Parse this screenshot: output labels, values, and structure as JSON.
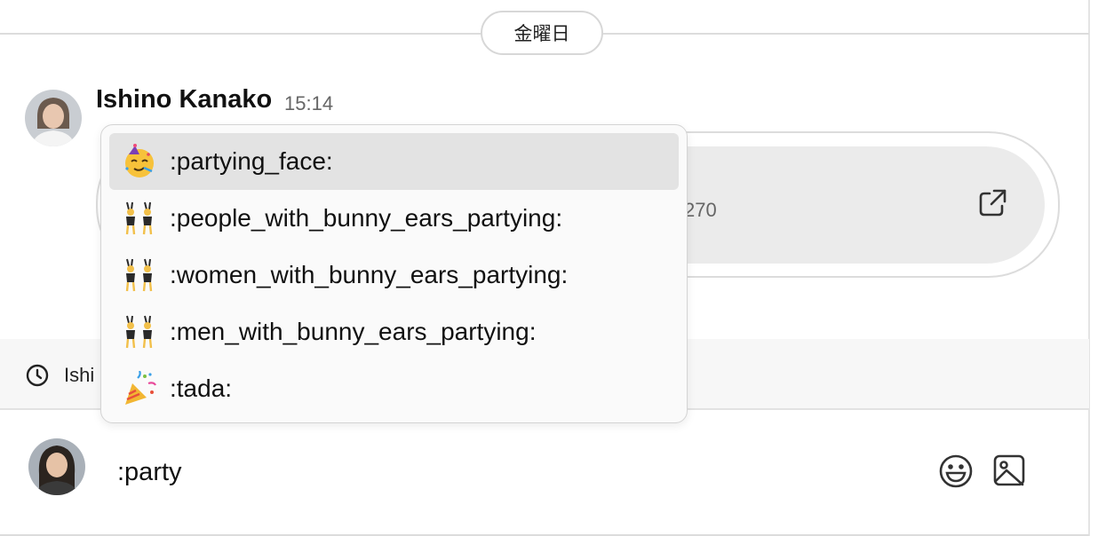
{
  "date_separator": {
    "label": "金曜日"
  },
  "message": {
    "author": "Ishino Kanako",
    "time": "15:14",
    "link_card": {
      "visible_text": "270"
    }
  },
  "info_bar": {
    "text": "Ishi"
  },
  "composer": {
    "value": ":party"
  },
  "suggestions": [
    {
      "code": ":partying_face:",
      "icon": "partying-face-icon",
      "selected": true
    },
    {
      "code": ":people_with_bunny_ears_partying:",
      "icon": "bunny-ears-icon",
      "selected": false
    },
    {
      "code": ":women_with_bunny_ears_partying:",
      "icon": "bunny-ears-icon",
      "selected": false
    },
    {
      "code": ":men_with_bunny_ears_partying:",
      "icon": "bunny-ears-icon",
      "selected": false
    },
    {
      "code": ":tada:",
      "icon": "tada-icon",
      "selected": false
    }
  ],
  "colors": {
    "selected_row": "#e3e3e3",
    "popup_bg": "#fafafa",
    "card_inner": "#ebebeb"
  }
}
